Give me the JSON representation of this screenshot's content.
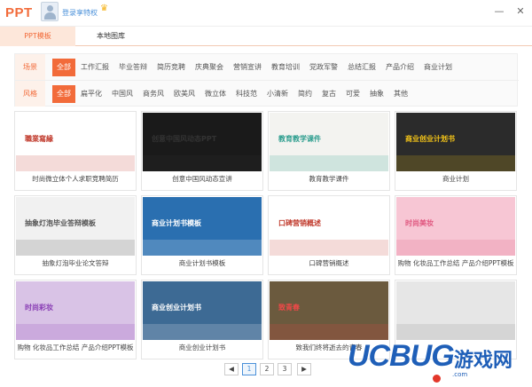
{
  "app": {
    "logo_text": "PPT",
    "login_text": "登录享特权",
    "crown_glyph": "♛",
    "minimize_glyph": "—",
    "close_glyph": "✕"
  },
  "tabs": [
    {
      "label": "PPT模板",
      "active": true
    },
    {
      "label": "本地图库",
      "active": false
    }
  ],
  "filters": {
    "scene": {
      "label": "场景",
      "options": [
        "全部",
        "工作汇报",
        "毕业答辩",
        "简历竞聘",
        "庆典聚会",
        "营销宣讲",
        "教育培训",
        "党政军警",
        "总结汇报",
        "产品介绍",
        "商业计划"
      ],
      "selected": "全部"
    },
    "style": {
      "label": "风格",
      "options": [
        "全部",
        "扁平化",
        "中国风",
        "商务风",
        "欧美风",
        "微立体",
        "科技范",
        "小清新",
        "简约",
        "复古",
        "可爱",
        "抽象",
        "其他"
      ],
      "selected": "全部"
    }
  },
  "thumbnails": [
    {
      "caption": "时尚微立体个人求职竞聘简历",
      "text": "職業寫緣",
      "bg": "#ffffff",
      "fg": "#c0392b"
    },
    {
      "caption": "创意中国风动态宣讲",
      "text": "创意中国风动态PPT",
      "bg": "#1a1a1a",
      "fg": "#333333"
    },
    {
      "caption": "教育教学课件",
      "text": "教育教学课件",
      "bg": "#f3f3f0",
      "fg": "#2e9e8f"
    },
    {
      "caption": "商业计划",
      "text": "商业创业计划书",
      "bg": "#2b2b2b",
      "fg": "#f5c518"
    },
    {
      "caption": "抽象灯泡毕业论文答辩",
      "text": "抽象灯泡毕业答辩模板",
      "bg": "#f1f1f1",
      "fg": "#555555"
    },
    {
      "caption": "商业计划书模板",
      "text": "商业计划书模板",
      "bg": "#2a6fb0",
      "fg": "#ffffff"
    },
    {
      "caption": "口碑营销概述",
      "text": "口碑营销概述",
      "bg": "#ffffff",
      "fg": "#c0392b"
    },
    {
      "caption": "购物 化妆品工作总结 产品介绍PPT模板",
      "text": "时尚美妆",
      "bg": "#f7c6d4",
      "fg": "#e05880"
    },
    {
      "caption": "购物 化妆品工作总结 产品介绍PPT模板",
      "text": "时尚彩妆",
      "bg": "#d9c3e6",
      "fg": "#8a3fb5"
    },
    {
      "caption": "商业创业计划书",
      "text": "商业创业计划书",
      "bg": "#3d6a94",
      "fg": "#ffffff"
    },
    {
      "caption": "致我们终将逝去的青春",
      "text": "致青春",
      "bg": "#6b5a3e",
      "fg": "#f04848"
    },
    {
      "caption": "",
      "text": "",
      "bg": "#e6e6e6",
      "fg": "#888888"
    }
  ],
  "pagination": {
    "prev": "◀",
    "next": "▶",
    "pages": [
      "1",
      "2",
      "3"
    ],
    "current": "1"
  },
  "watermark": {
    "brand": "UCBUG",
    "cn": "游戏网",
    "url": ".com"
  },
  "colors": {
    "accent": "#f26b3a",
    "link": "#4a90d9",
    "watermark": "#1f5fb8"
  }
}
